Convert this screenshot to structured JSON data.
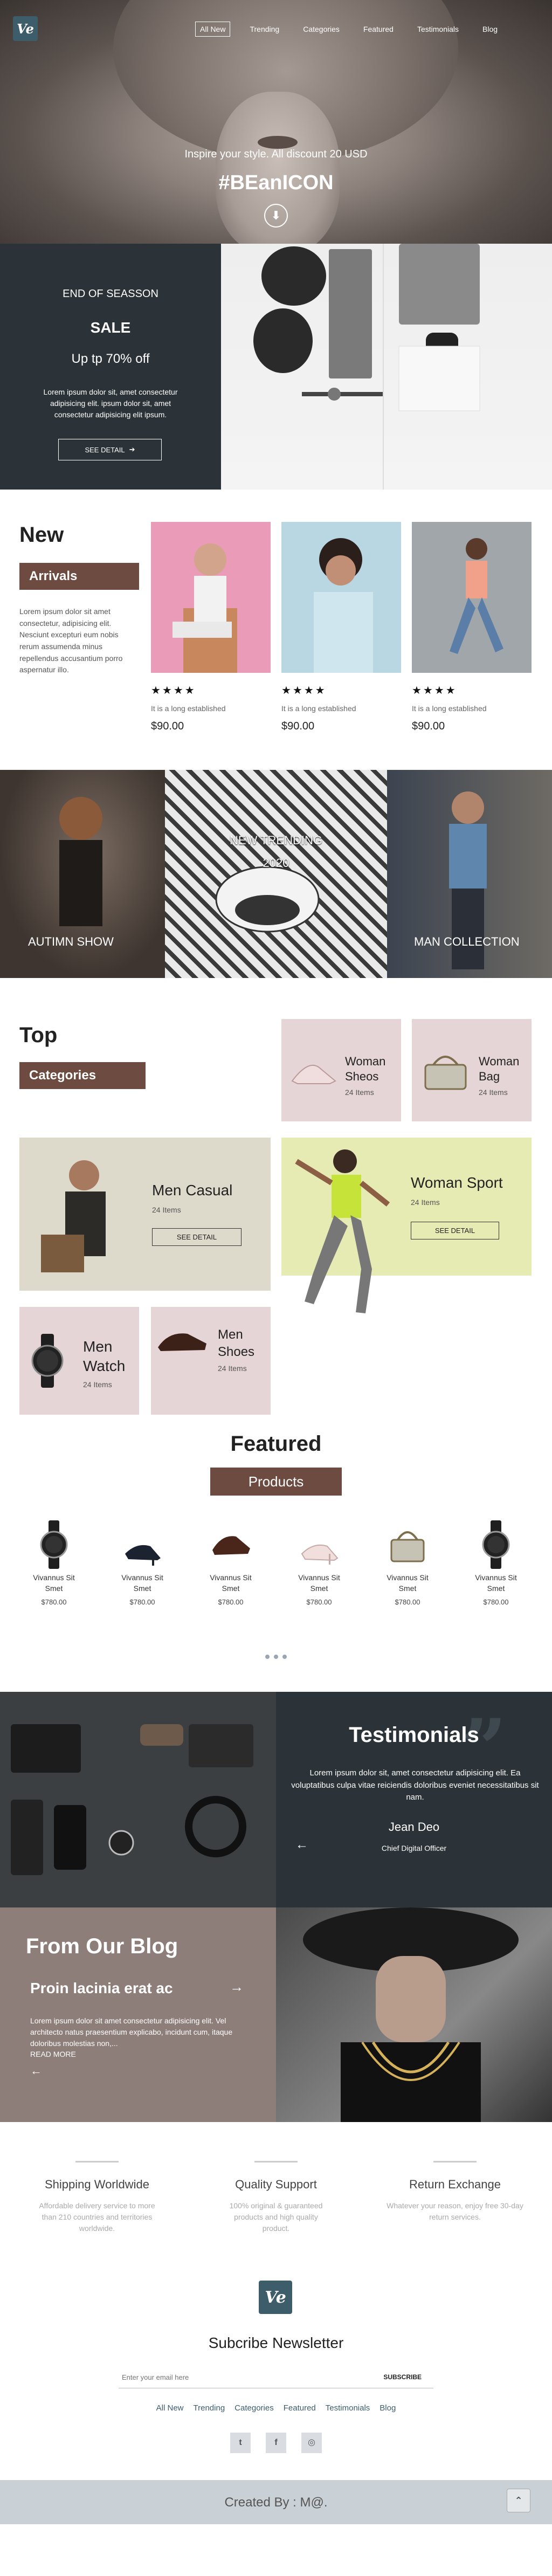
{
  "nav": {
    "items": [
      "All New",
      "Trending",
      "Categories",
      "Featured",
      "Testimonials",
      "Blog"
    ]
  },
  "logo": {
    "text": "Ve"
  },
  "hero": {
    "subtitle": "Inspire your style. All discount 20 USD",
    "title": "#BEanICON"
  },
  "sale": {
    "eyebrow": "END OF SEASSON",
    "title": "SALE",
    "headline": "Up tp 70% off",
    "body": "Lorem ipsum dolor sit, amet consectetur adipisicing elit. ipsum dolor sit, amet consectetur adipisicing elit ipsum.",
    "button": "SEE DETAIL"
  },
  "new_arrivals": {
    "title": "New",
    "tag": "Arrivals",
    "body": "Lorem ipsum dolor sit amet consectetur, adipisicing elit. Nesciunt excepturi eum nobis rerum assumenda minus repellendus accusantium porro aspernatur illo.",
    "products": [
      {
        "desc": "It is a long established",
        "price": "$90.00",
        "rating": 4
      },
      {
        "desc": "It is a long established",
        "price": "$90.00",
        "rating": 4
      },
      {
        "desc": "It is a long established",
        "price": "$90.00",
        "rating": 4
      }
    ]
  },
  "collections": {
    "left": "AUTIMN SHOW",
    "center_line1": "NEW TRENDING",
    "center_line2": "2020",
    "right": "MAN COLLECTION"
  },
  "top_categories": {
    "title": "Top",
    "tag": "Categories",
    "woman_shoes": {
      "name_line1": "Woman",
      "name_line2": "Sheos",
      "count": "24 Items"
    },
    "woman_bag": {
      "name_line1": "Woman",
      "name_line2": "Bag",
      "count": "24 Items"
    },
    "men_casual": {
      "name": "Men Casual",
      "count": "24 Items",
      "button": "SEE DETAIL"
    },
    "woman_sport": {
      "name": "Woman Sport",
      "count": "24 Items",
      "button": "SEE DETAIL"
    },
    "men_watch": {
      "name_line1": "Men",
      "name_line2": "Watch",
      "count": "24 Items"
    },
    "men_shoes": {
      "name_line1": "Men",
      "name_line2": "Shoes",
      "count": "24 Items"
    }
  },
  "featured": {
    "title": "Featured",
    "tag": "Products",
    "products": [
      {
        "name_line1": "Vivannus Sit",
        "name_line2": "Smet",
        "price": "$780.00",
        "icon": "watch-icon"
      },
      {
        "name_line1": "Vivannus Sit",
        "name_line2": "Smet",
        "price": "$780.00",
        "icon": "heels-icon"
      },
      {
        "name_line1": "Vivannus Sit",
        "name_line2": "Smet",
        "price": "$780.00",
        "icon": "loafers-icon"
      },
      {
        "name_line1": "Vivannus Sit",
        "name_line2": "Smet",
        "price": "$780.00",
        "icon": "pumps-icon"
      },
      {
        "name_line1": "Vivannus Sit",
        "name_line2": "Smet",
        "price": "$780.00",
        "icon": "handbag-icon"
      },
      {
        "name_line1": "Vivannus Sit",
        "name_line2": "Smet",
        "price": "$780.00",
        "icon": "watch-icon"
      }
    ]
  },
  "testimonials": {
    "title": "Testimonials",
    "body": "Lorem ipsum dolor sit, amet consectetur adipisicing elit. Ea voluptatibus culpa vitae reiciendis doloribus eveniet necessitatibus sit nam.",
    "name": "Jean Deo",
    "role": "Chief Digital Officer"
  },
  "blog": {
    "title": "From Our Blog",
    "post_title": "Proin lacinia erat ac",
    "body": "Lorem ipsum dolor sit amet consectetur adipisicing elit. Vel architecto natus praesentium explicabo, incidunt cum, itaque doloribus molestias non,...",
    "read_more": "READ MORE"
  },
  "features": [
    {
      "title": "Shipping Worldwide",
      "body": "Affordable delivery service to more than 210 countries and territories worldwide."
    },
    {
      "title": "Quality Support",
      "body": "100% original & guaranteed products and high quality product."
    },
    {
      "title": "Return Exchange",
      "body": "Whatever your reason, enjoy free 30-day return services."
    }
  ],
  "newsletter": {
    "title": "Subcribe Newsletter",
    "placeholder": "Enter your email here",
    "button": "SUBSCRIBE"
  },
  "footer_nav": [
    "All New",
    "Trending",
    "Categories",
    "Featured",
    "Testimonials",
    "Blog"
  ],
  "social": [
    "twitter-icon",
    "facebook-icon",
    "instagram-icon"
  ],
  "social_glyphs": [
    "t",
    "f",
    "◎"
  ],
  "footer": {
    "credit": "Created By : M@."
  },
  "colors": {
    "dark_slate": "#2b3338",
    "brown_tag": "#6d4b41",
    "pink_card": "#e6d5d6",
    "beige_card": "#ddd9cb",
    "lime_card": "#e6ebb3",
    "mauve_blog": "#8e7e7a",
    "footer_bar": "#c9d0d6"
  }
}
